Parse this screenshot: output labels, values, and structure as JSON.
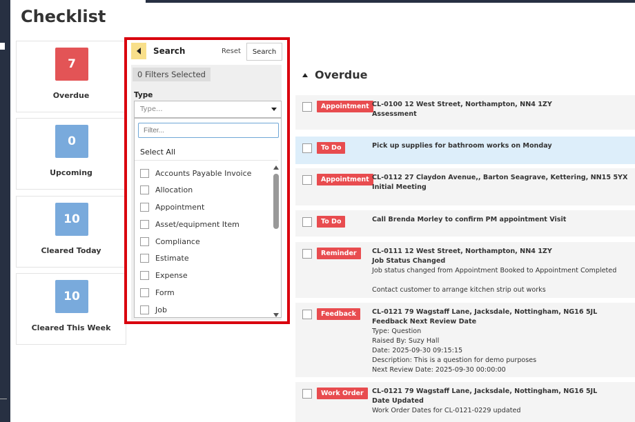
{
  "page": {
    "title": "Checklist"
  },
  "cards": [
    {
      "count": "7",
      "label": "Overdue",
      "color": "#e35456"
    },
    {
      "count": "0",
      "label": "Upcoming",
      "color": "#79aadc"
    },
    {
      "count": "10",
      "label": "Cleared Today",
      "color": "#79aadc"
    },
    {
      "count": "10",
      "label": "Cleared This Week",
      "color": "#79aadc"
    }
  ],
  "filter": {
    "title": "Search",
    "reset_label": "Reset",
    "search_label": "Search",
    "filters_selected": "0 Filters Selected",
    "type_label": "Type",
    "type_placeholder": "Type...",
    "filter_placeholder": "Filter...",
    "select_all": "Select All",
    "options": [
      "Accounts Payable Invoice",
      "Allocation",
      "Appointment",
      "Asset/equipment Item",
      "Compliance",
      "Estimate",
      "Expense",
      "Form",
      "Job"
    ]
  },
  "overdue": {
    "heading": "Overdue",
    "items": [
      {
        "badge": "Appointment",
        "lines": [
          "CL-0100 12 West Street, Northampton, NN4 1ZY",
          "Assessment"
        ],
        "details": []
      },
      {
        "badge": "To Do",
        "lines": [
          "Pick up supplies for bathroom works on Monday"
        ],
        "details": []
      },
      {
        "badge": "Appointment",
        "lines": [
          "CL-0112 27 Claydon Avenue,, Barton Seagrave, Kettering, NN15 5YX",
          "Initial Meeting"
        ],
        "details": []
      },
      {
        "badge": "To Do",
        "lines": [
          "Call Brenda Morley to confirm PM appointment Visit"
        ],
        "details": []
      },
      {
        "badge": "Reminder",
        "lines": [
          "CL-0111 12 West Street, Northampton, NN4 1ZY",
          "Job Status Changed"
        ],
        "details": [
          "Job status changed from Appointment Booked to Appointment Completed",
          "",
          "Contact customer to arrange  kitchen strip out works"
        ]
      },
      {
        "badge": "Feedback",
        "lines": [
          "CL-0121 79 Wagstaff Lane, Jacksdale, Nottingham, NG16 5JL",
          "Feedback Next Review Date"
        ],
        "details": [
          "Type: Question",
          "Raised By: Suzy Hall",
          "Date: 2025-09-30 09:15:15",
          "Description: This is a question for demo purposes",
          "Next Review Date: 2025-09-30 00:00:00"
        ]
      },
      {
        "badge": "Work Order",
        "lines": [
          "CL-0121 79 Wagstaff Lane, Jacksdale, Nottingham, NG16 5JL",
          "Date Updated"
        ],
        "details": [
          "Work Order Dates for CL-0121-0229 updated"
        ]
      }
    ]
  }
}
